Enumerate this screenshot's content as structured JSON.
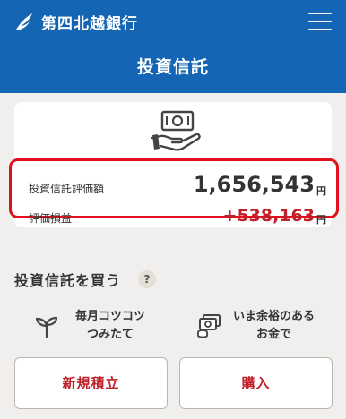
{
  "header": {
    "bank_name": "第四北越銀行",
    "page_title": "投資信託"
  },
  "summary": {
    "valuation_label": "投資信託評価額",
    "valuation_value": "1,656,543",
    "valuation_unit": "円",
    "gain_label": "評価損益",
    "gain_value": "+538,163",
    "gain_unit": "円"
  },
  "buy_section": {
    "title": "投資信託を買う",
    "help_label": "?",
    "options": [
      {
        "line1": "毎月コツコツ",
        "line2": "つみたて",
        "icon": "sprout-icon"
      },
      {
        "line1": "いま余裕のある",
        "line2": "お金で",
        "icon": "money-stack-icon"
      }
    ],
    "buttons": {
      "new_saving": "新規積立",
      "purchase": "購入"
    }
  },
  "colors": {
    "header_bg": "#1565b5",
    "accent_red": "#c0202a",
    "highlight_border": "#e0101c",
    "background": "#f1efed"
  }
}
